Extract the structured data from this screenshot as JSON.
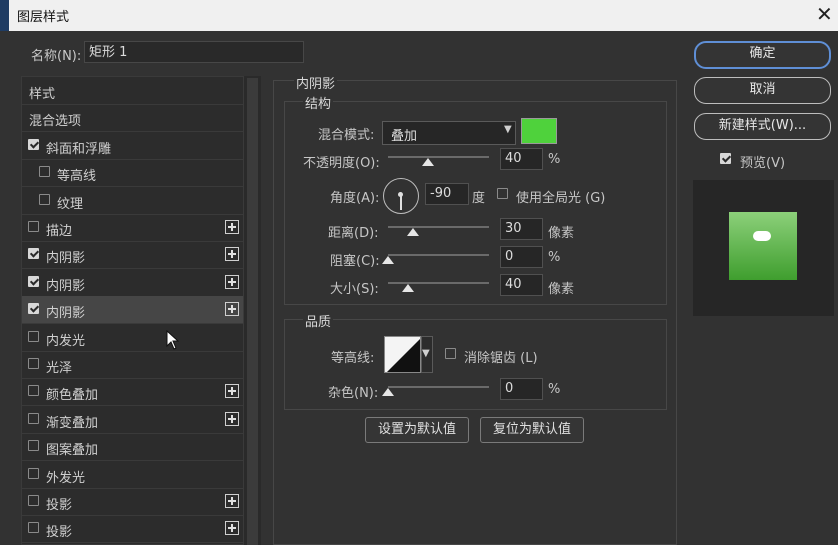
{
  "window": {
    "title": "图层样式",
    "close_icon": "close-icon"
  },
  "name_field": {
    "label": "名称(N):",
    "value": "矩形 1"
  },
  "style_list": {
    "header": "样式",
    "items": [
      {
        "label": "混合选项",
        "checkbox": false,
        "checked": false,
        "plus": false,
        "indent": 0
      },
      {
        "label": "斜面和浮雕",
        "checkbox": true,
        "checked": true,
        "plus": false,
        "indent": 0
      },
      {
        "label": "等高线",
        "checkbox": true,
        "checked": false,
        "plus": false,
        "indent": 1
      },
      {
        "label": "纹理",
        "checkbox": true,
        "checked": false,
        "plus": false,
        "indent": 1
      },
      {
        "label": "描边",
        "checkbox": true,
        "checked": false,
        "plus": true,
        "indent": 0
      },
      {
        "label": "内阴影",
        "checkbox": true,
        "checked": true,
        "plus": true,
        "indent": 0
      },
      {
        "label": "内阴影",
        "checkbox": true,
        "checked": true,
        "plus": true,
        "indent": 0
      },
      {
        "label": "内阴影",
        "checkbox": true,
        "checked": true,
        "plus": true,
        "indent": 0,
        "selected": true
      },
      {
        "label": "内发光",
        "checkbox": true,
        "checked": false,
        "plus": false,
        "indent": 0
      },
      {
        "label": "光泽",
        "checkbox": true,
        "checked": false,
        "plus": false,
        "indent": 0
      },
      {
        "label": "颜色叠加",
        "checkbox": true,
        "checked": false,
        "plus": true,
        "indent": 0
      },
      {
        "label": "渐变叠加",
        "checkbox": true,
        "checked": false,
        "plus": true,
        "indent": 0
      },
      {
        "label": "图案叠加",
        "checkbox": true,
        "checked": false,
        "plus": false,
        "indent": 0
      },
      {
        "label": "外发光",
        "checkbox": true,
        "checked": false,
        "plus": false,
        "indent": 0
      },
      {
        "label": "投影",
        "checkbox": true,
        "checked": false,
        "plus": true,
        "indent": 0
      },
      {
        "label": "投影",
        "checkbox": true,
        "checked": false,
        "plus": true,
        "indent": 0
      }
    ]
  },
  "inner_shadow": {
    "section_title": "内阴影",
    "structure_title": "结构",
    "blend_mode": {
      "label": "混合模式:",
      "value": "叠加",
      "color": "#4fd23c"
    },
    "opacity": {
      "label": "不透明度(O):",
      "value": "40",
      "unit": "%",
      "fraction": 0.4
    },
    "angle": {
      "label": "角度(A):",
      "value": "-90",
      "unit": "度",
      "global_light_label": "使用全局光 (G)",
      "global_light_checked": false
    },
    "distance": {
      "label": "距离(D):",
      "value": "30",
      "unit": "像素",
      "fraction": 0.25
    },
    "choke": {
      "label": "阻塞(C):",
      "value": "0",
      "unit": "%",
      "fraction": 0.0
    },
    "size": {
      "label": "大小(S):",
      "value": "40",
      "unit": "像素",
      "fraction": 0.2
    },
    "quality_title": "品质",
    "contour": {
      "label": "等高线:",
      "anti_alias_label": "消除锯齿 (L)",
      "anti_alias_checked": false
    },
    "noise": {
      "label": "杂色(N):",
      "value": "0",
      "unit": "%",
      "fraction": 0.0
    },
    "set_default": "设置为默认值",
    "reset_default": "复位为默认值"
  },
  "buttons": {
    "ok": "确定",
    "cancel": "取消",
    "new_style": "新建样式(W)..."
  },
  "preview": {
    "label": "预览(V)",
    "checked": true,
    "fill_top": "#8cd07a",
    "fill_bottom": "#3f9e2e"
  }
}
